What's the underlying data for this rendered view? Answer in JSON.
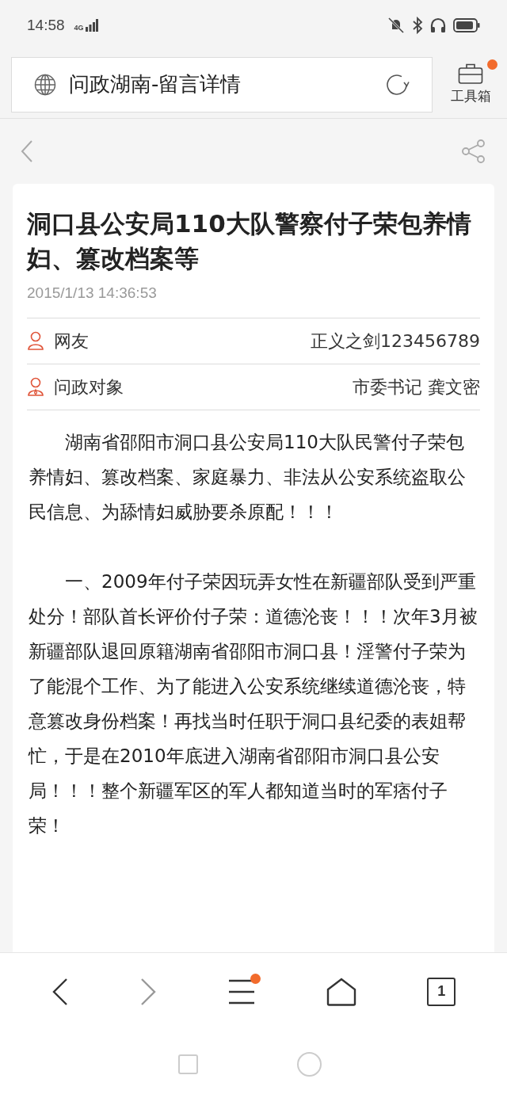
{
  "status_bar": {
    "time": "14:58",
    "network": "4G"
  },
  "address_bar": {
    "title": "问政湖南-留言详情"
  },
  "toolbox": {
    "label": "工具箱",
    "badge": true
  },
  "article": {
    "title": "洞口县公安局110大队警察付子荣包养情妇、篡改档案等",
    "date": "2015/1/13 14:36:53",
    "meta": [
      {
        "kind": "user",
        "label": "网友",
        "value": "正义之剑123456789"
      },
      {
        "kind": "official",
        "label": "问政对象",
        "value": "市委书记 龚文密"
      }
    ],
    "paragraphs": [
      "湖南省邵阳市洞口县公安局110大队民警付子荣包养情妇、篡改档案、家庭暴力、非法从公安系统盗取公民信息、为舔情妇威胁要杀原配！！！",
      "一、2009年付子荣因玩弄女性在新疆部队受到严重处分！部队首长评价付子荣：道德沦丧！！！次年3月被新疆部队退回原籍湖南省邵阳市洞口县！淫警付子荣为了能混个工作、为了能进入公安系统继续道德沦丧，特意篡改身份档案！再找当时任职于洞口县纪委的表姐帮忙，于是在2010年底进入湖南省邵阳市洞口县公安局！！！整个新疆军区的军人都知道当时的军痞付子荣！"
    ]
  },
  "bottom_nav": {
    "forward_disabled": true,
    "menu_badge": true,
    "tab_count": "1"
  }
}
